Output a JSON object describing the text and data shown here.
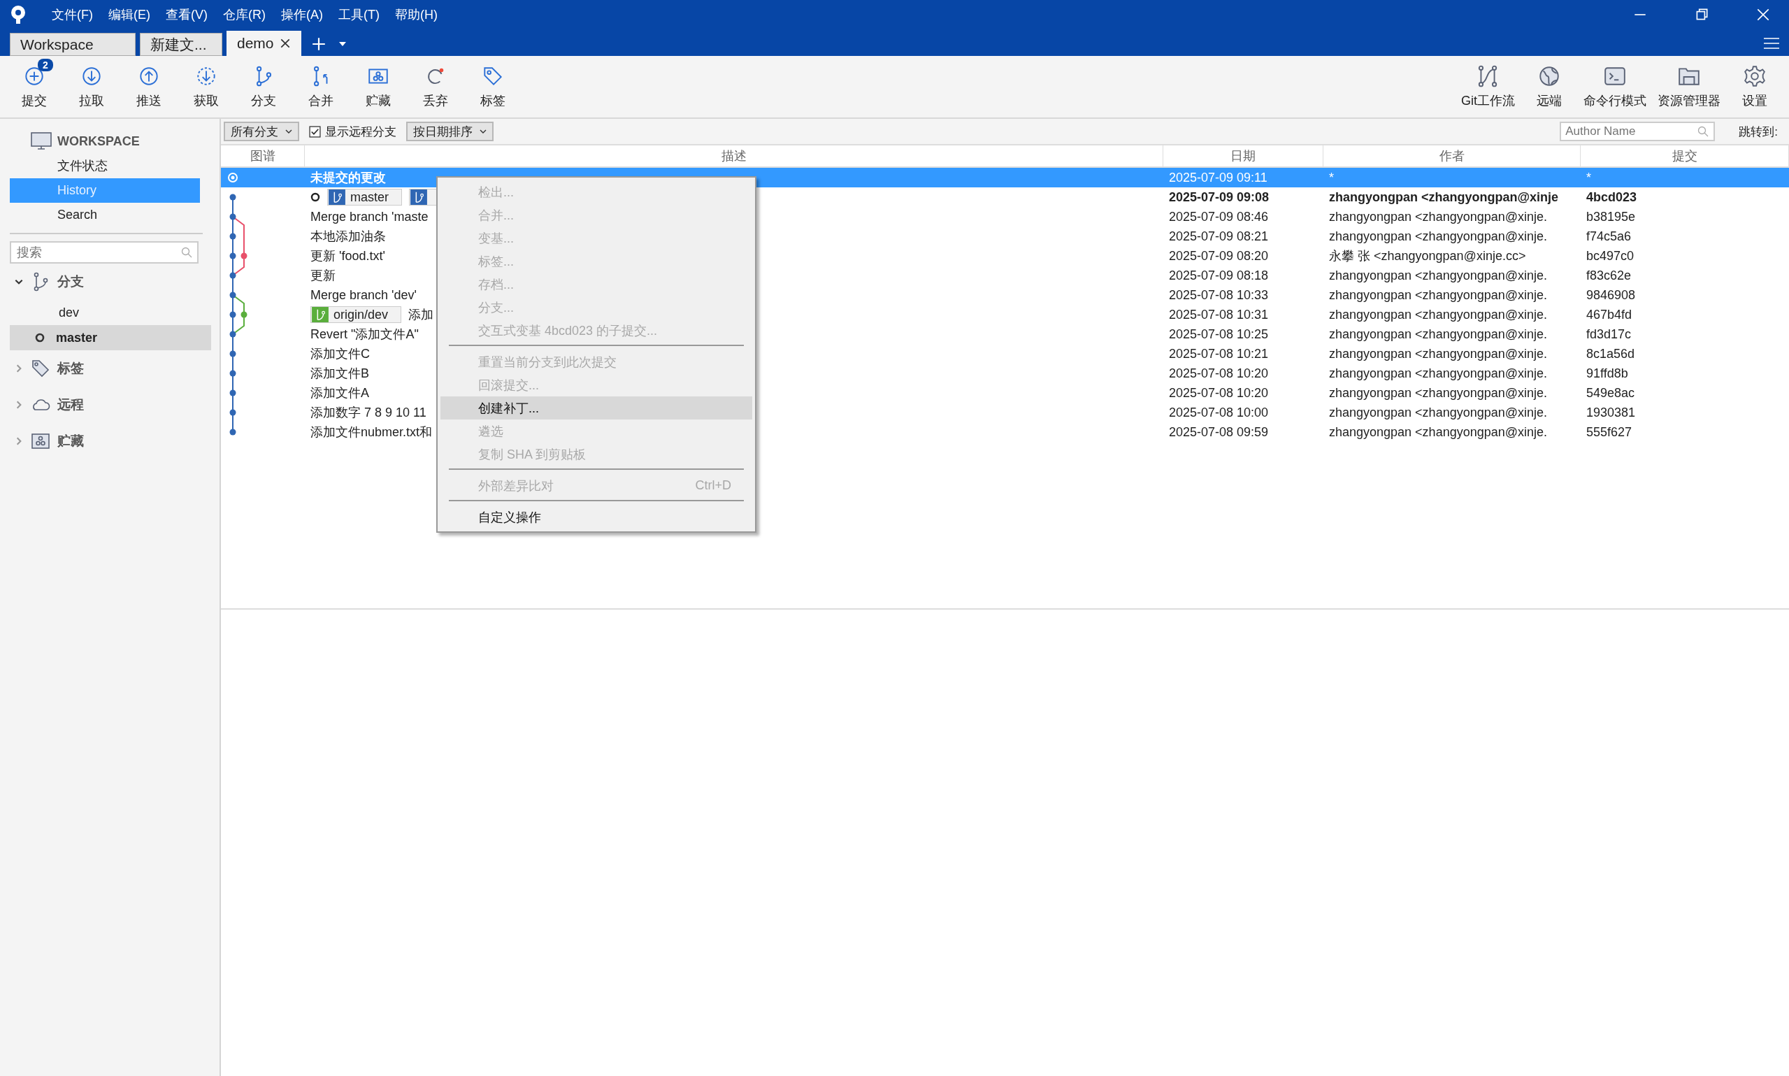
{
  "menu": [
    "文件(F)",
    "编辑(E)",
    "查看(V)",
    "仓库(R)",
    "操作(A)",
    "工具(T)",
    "帮助(H)"
  ],
  "tabs": [
    {
      "label": "Workspace",
      "selected": false,
      "closable": false
    },
    {
      "label": "新建文...",
      "selected": false,
      "closable": false
    },
    {
      "label": "demo",
      "selected": true,
      "closable": true
    }
  ],
  "toolbar_left": [
    {
      "label": "提交",
      "kind": "commit",
      "badge": "2"
    },
    {
      "label": "拉取",
      "kind": "pull"
    },
    {
      "label": "推送",
      "kind": "push"
    },
    {
      "label": "获取",
      "kind": "fetch"
    },
    {
      "label": "分支",
      "kind": "branch"
    },
    {
      "label": "合并",
      "kind": "merge"
    },
    {
      "label": "贮藏",
      "kind": "stash"
    },
    {
      "label": "丢弃",
      "kind": "discard"
    },
    {
      "label": "标签",
      "kind": "tag"
    }
  ],
  "toolbar_right": [
    {
      "label": "Git工作流",
      "kind": "gitflow"
    },
    {
      "label": "远端",
      "kind": "remote"
    },
    {
      "label": "命令行模式",
      "kind": "terminal"
    },
    {
      "label": "资源管理器",
      "kind": "explorer"
    },
    {
      "label": "设置",
      "kind": "settings"
    }
  ],
  "filter": {
    "branches": "所有分支",
    "show_remote": {
      "label": "显示远程分支",
      "checked": true
    },
    "sort": "按日期排序",
    "author": {
      "placeholder": "Author Name"
    },
    "jump": "跳转到:"
  },
  "sidebar": {
    "workspace": "WORKSPACE",
    "views": [
      {
        "label": "文件状态",
        "selected": false
      },
      {
        "label": "History",
        "selected": true
      },
      {
        "label": "Search",
        "selected": false
      }
    ],
    "search": {
      "placeholder": "搜索"
    },
    "sections": [
      {
        "label": "分支",
        "kind": "branches",
        "expanded": true,
        "children": [
          {
            "label": "dev",
            "current": false,
            "selected": false
          },
          {
            "label": "master",
            "current": true,
            "selected": true
          }
        ]
      },
      {
        "label": "标签",
        "kind": "tags",
        "expanded": false
      },
      {
        "label": "远程",
        "kind": "remotes",
        "expanded": false
      },
      {
        "label": "贮藏",
        "kind": "stashes",
        "expanded": false
      }
    ]
  },
  "table": {
    "columns": [
      "图谱",
      "描述",
      "日期",
      "作者",
      "提交"
    ],
    "rows": [
      {
        "description": "未提交的更改",
        "date": "2025-07-09 09:11",
        "author": "*",
        "commit": "*",
        "selected": true,
        "head": false
      },
      {
        "description": "",
        "refs": [
          {
            "label": "master",
            "kind": "local"
          },
          {
            "kind": "local"
          }
        ],
        "date": "2025-07-09 09:08",
        "author": "zhangyongpan <zhangyongpan@xinje",
        "commit": "4bcd023",
        "selected": false,
        "head": true
      },
      {
        "description": "Merge branch 'maste",
        "date": "2025-07-09 08:46",
        "author": "zhangyongpan <zhangyongpan@xinje.",
        "commit": "b38195e",
        "selected": false,
        "head": false
      },
      {
        "description": "本地添加油条",
        "date": "2025-07-09 08:21",
        "author": "zhangyongpan <zhangyongpan@xinje.",
        "commit": "f74c5a6",
        "selected": false,
        "head": false
      },
      {
        "description": "更新 'food.txt'",
        "date": "2025-07-09 08:20",
        "author": "永攀 张 <zhangyongpan@xinje.cc>",
        "commit": "bc497c0",
        "selected": false,
        "head": false
      },
      {
        "description": "更新",
        "date": "2025-07-09 08:18",
        "author": "zhangyongpan <zhangyongpan@xinje.",
        "commit": "f83c62e",
        "selected": false,
        "head": false
      },
      {
        "description": "Merge branch 'dev'",
        "date": "2025-07-08 10:33",
        "author": "zhangyongpan <zhangyongpan@xinje.",
        "commit": "9846908",
        "selected": false,
        "head": false
      },
      {
        "description": "添加",
        "refs": [
          {
            "label": "origin/dev",
            "kind": "remote"
          }
        ],
        "date": "2025-07-08 10:31",
        "author": "zhangyongpan <zhangyongpan@xinje.",
        "commit": "467b4fd",
        "selected": false,
        "head": false
      },
      {
        "description": "Revert \"添加文件A\"",
        "date": "2025-07-08 10:25",
        "author": "zhangyongpan <zhangyongpan@xinje.",
        "commit": "fd3d17c",
        "selected": false,
        "head": false
      },
      {
        "description": "添加文件C",
        "date": "2025-07-08 10:21",
        "author": "zhangyongpan <zhangyongpan@xinje.",
        "commit": "8c1a56d",
        "selected": false,
        "head": false
      },
      {
        "description": "添加文件B",
        "date": "2025-07-08 10:20",
        "author": "zhangyongpan <zhangyongpan@xinje.",
        "commit": "91ffd8b",
        "selected": false,
        "head": false
      },
      {
        "description": "添加文件A",
        "date": "2025-07-08 10:20",
        "author": "zhangyongpan <zhangyongpan@xinje.",
        "commit": "549e8ac",
        "selected": false,
        "head": false
      },
      {
        "description": "添加数字 7 8 9 10 11",
        "date": "2025-07-08 10:00",
        "author": "zhangyongpan <zhangyongpan@xinje.",
        "commit": "1930381",
        "selected": false,
        "head": false
      },
      {
        "description": "添加文件nubmer.txt和",
        "date": "2025-07-08 09:59",
        "author": "zhangyongpan <zhangyongpan@xinje.",
        "commit": "555f627",
        "selected": false,
        "head": false
      }
    ]
  },
  "context_menu": [
    {
      "kind": "item",
      "label": "检出...",
      "disabled": true,
      "selected": false
    },
    {
      "kind": "item",
      "label": "合并...",
      "disabled": true,
      "selected": false
    },
    {
      "kind": "item",
      "label": "变基...",
      "disabled": true,
      "selected": false
    },
    {
      "kind": "item",
      "label": "标签...",
      "disabled": true,
      "selected": false
    },
    {
      "kind": "item",
      "label": "存档...",
      "disabled": true,
      "selected": false
    },
    {
      "kind": "item",
      "label": "分支...",
      "disabled": true,
      "selected": false
    },
    {
      "kind": "item",
      "label": "交互式变基 4bcd023 的子提交...",
      "disabled": true,
      "selected": false
    },
    {
      "kind": "separator"
    },
    {
      "kind": "item",
      "label": "重置当前分支到此次提交",
      "disabled": true,
      "selected": false
    },
    {
      "kind": "item",
      "label": "回滚提交...",
      "disabled": true,
      "selected": false
    },
    {
      "kind": "item",
      "label": "创建补丁...",
      "disabled": false,
      "selected": true
    },
    {
      "kind": "item",
      "label": "遴选",
      "disabled": true,
      "selected": false
    },
    {
      "kind": "item",
      "label": "复制 SHA 到剪贴板",
      "disabled": true,
      "selected": false
    },
    {
      "kind": "separator"
    },
    {
      "kind": "item",
      "label": "外部差异比对",
      "shortcut": "Ctrl+D",
      "disabled": true,
      "selected": false
    },
    {
      "kind": "separator"
    },
    {
      "kind": "item",
      "label": "自定义操作",
      "disabled": false,
      "selected": false
    }
  ]
}
